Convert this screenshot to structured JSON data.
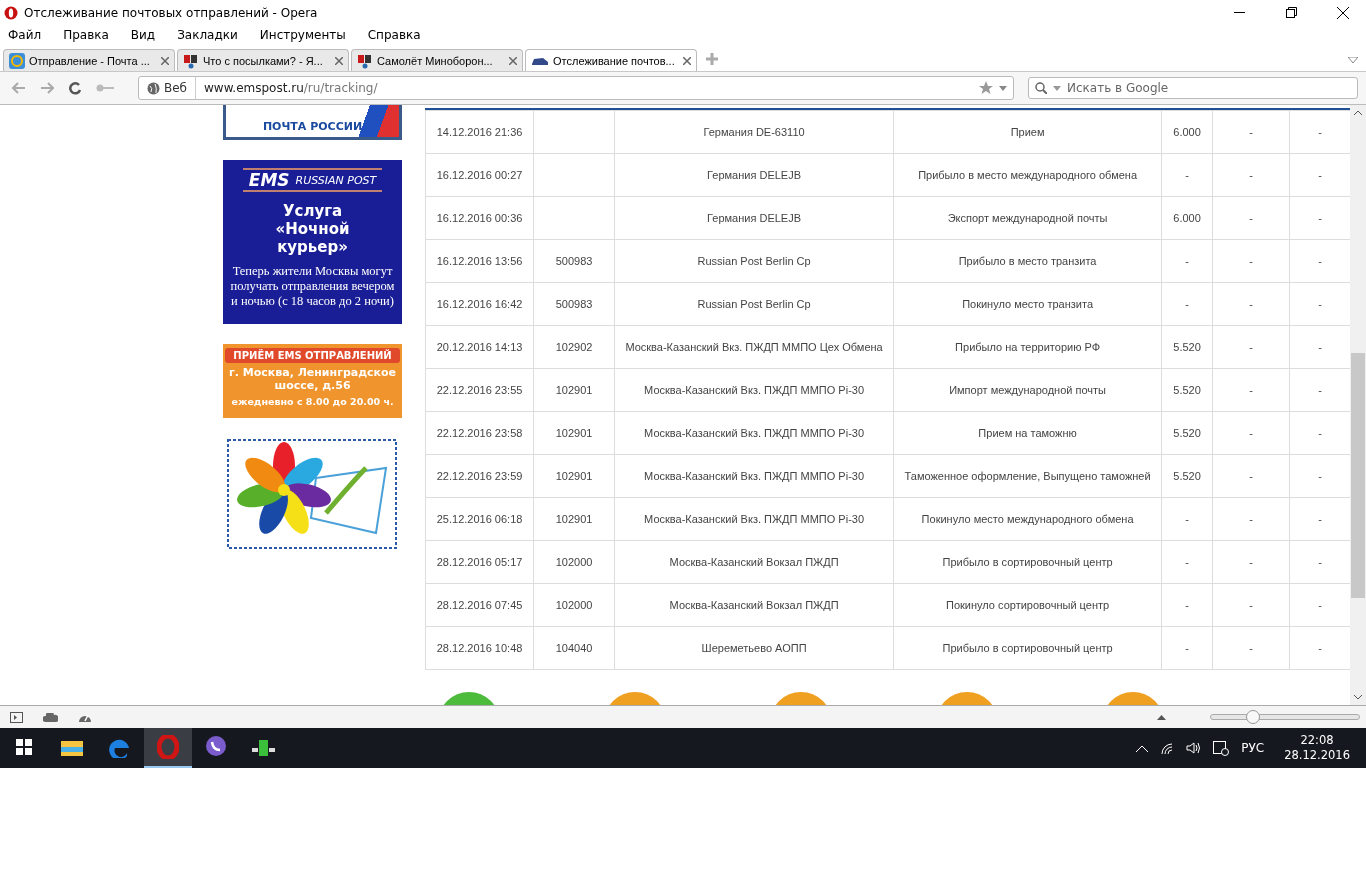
{
  "window": {
    "title": "Отслеживание почтовых отправлений - Opera"
  },
  "menu": [
    "Файл",
    "Правка",
    "Вид",
    "Закладки",
    "Инструменты",
    "Справка"
  ],
  "tabs": [
    {
      "label": "Отправление - Почта ...",
      "selected": false,
      "kind": "mail"
    },
    {
      "label": "Что с посылками? - Я...",
      "selected": false,
      "kind": "yap"
    },
    {
      "label": "Самолёт Миноборон...",
      "selected": false,
      "kind": "yap"
    },
    {
      "label": "Отслеживание почтов...",
      "selected": true,
      "kind": "car"
    }
  ],
  "address": {
    "scope": "Веб",
    "domain": "www.emspost.ru",
    "path": "/ru/tracking/"
  },
  "search": {
    "placeholder": "Искать в Google"
  },
  "banners": {
    "pochta": "ПОЧТА РОССИИ",
    "ems_logo": "EMS",
    "ems_sub": "RUSSIAN POST",
    "ems_title": "Услуга «Ночной курьер»",
    "ems_text": "Теперь жители Москвы могут получать отправления вечером и ночью (с 18 часов до 2 ночи)",
    "orange_head": "ПРИЁМ EMS ОТПРАВЛЕНИЙ",
    "orange_addr": "г. Москва, Ленинградское шоссе, д.56",
    "orange_hours": "ежедневно с 8.00 до 20.00 ч."
  },
  "table": {
    "rows": [
      {
        "cells": [
          "14.12.2016 21:36",
          "",
          "Германия DE-63110",
          "Прием",
          "6.000",
          "-",
          "-"
        ]
      },
      {
        "cells": [
          "16.12.2016 00:27",
          "",
          "Германия DELEJB",
          "Прибыло в место международного обмена",
          "-",
          "-",
          "-"
        ]
      },
      {
        "cells": [
          "16.12.2016 00:36",
          "",
          "Германия DELEJB",
          "Экспорт международной почты",
          "6.000",
          "-",
          "-"
        ]
      },
      {
        "cells": [
          "16.12.2016 13:56",
          "500983",
          "Russian Post Berlin Cp",
          "Прибыло в место транзита",
          "-",
          "-",
          "-"
        ]
      },
      {
        "cells": [
          "16.12.2016 16:42",
          "500983",
          "Russian Post Berlin Cp",
          "Покинуло место транзита",
          "-",
          "-",
          "-"
        ]
      },
      {
        "cells": [
          "20.12.2016 14:13",
          "102902",
          "Москва-Казанский Вкз. ПЖДП ММПО Цех Обмена",
          "Прибыло на территорию РФ",
          "5.520",
          "-",
          "-"
        ]
      },
      {
        "cells": [
          "22.12.2016 23:55",
          "102901",
          "Москва-Казанский Вкз. ПЖДП ММПО Pi-30",
          "Импорт международной почты",
          "5.520",
          "-",
          "-"
        ]
      },
      {
        "cells": [
          "22.12.2016 23:58",
          "102901",
          "Москва-Казанский Вкз. ПЖДП ММПО Pi-30",
          "Прием на таможню",
          "5.520",
          "-",
          "-"
        ]
      },
      {
        "cells": [
          "22.12.2016 23:59",
          "102901",
          "Москва-Казанский Вкз. ПЖДП ММПО Pi-30",
          "Таможенное оформление, Выпущено таможней",
          "5.520",
          "-",
          "-"
        ]
      },
      {
        "cells": [
          "25.12.2016 06:18",
          "102901",
          "Москва-Казанский Вкз. ПЖДП ММПО Pi-30",
          "Покинуло место международного обмена",
          "-",
          "-",
          "-"
        ]
      },
      {
        "cells": [
          "28.12.2016 05:17",
          "102000",
          "Москва-Казанский Вокзал ПЖДП",
          "Прибыло в сортировочный центр",
          "-",
          "-",
          "-"
        ]
      },
      {
        "cells": [
          "28.12.2016 07:45",
          "102000",
          "Москва-Казанский Вокзал ПЖДП",
          "Покинуло сортировочный центр",
          "-",
          "-",
          "-"
        ]
      },
      {
        "cells": [
          "28.12.2016 10:48",
          "104040",
          "Шереметьево АОПП",
          "Прибыло в сортировочный центр",
          "-",
          "-",
          "-"
        ]
      }
    ]
  },
  "service_icons": [
    {
      "color": "#4cbb3c"
    },
    {
      "color": "#f0a020"
    },
    {
      "color": "#f0a020"
    },
    {
      "color": "#f0a020"
    },
    {
      "color": "#f0a020"
    }
  ],
  "zoom": {
    "level": 0.28
  },
  "taskbar": {
    "apps": [
      {
        "kind": "folder",
        "active": false
      },
      {
        "kind": "edge",
        "active": false
      },
      {
        "kind": "opera",
        "active": true
      },
      {
        "kind": "viber",
        "active": false
      },
      {
        "kind": "drink",
        "active": false
      }
    ],
    "lang": "РУС",
    "time": "22:08",
    "date": "28.12.2016"
  }
}
